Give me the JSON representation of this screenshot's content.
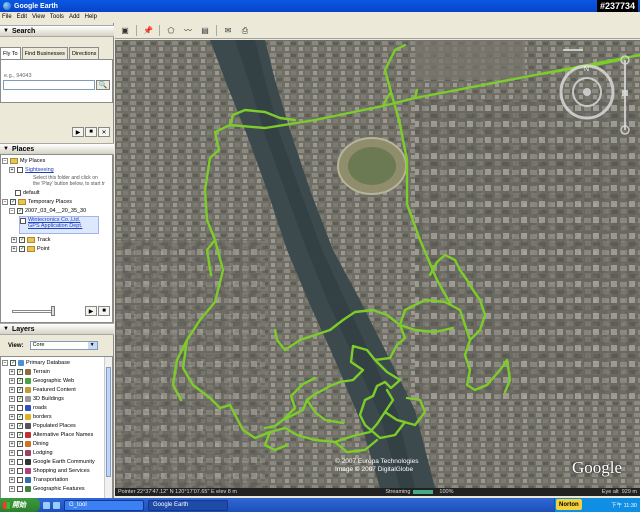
{
  "window": {
    "title": "Google Earth",
    "watermark": "#237734"
  },
  "menu": [
    "File",
    "Edit",
    "View",
    "Tools",
    "Add",
    "Help"
  ],
  "search": {
    "header": "Search",
    "tabs": [
      "Fly To",
      "Find Businesses",
      "Directions"
    ],
    "hint": "e.g., 94043",
    "value": ""
  },
  "places": {
    "header": "Places",
    "my_places": "My Places",
    "sightseeing": "Sightseeing",
    "desc_line1": "Select this folder and click on",
    "desc_line2": "the 'Play' button below, to start tr",
    "default": "default",
    "temporary": "Temporary Places",
    "file": "2007_03_04__20_35_30",
    "company": "Wintecronics Co.,Ltd.",
    "dept": "GPS Application Dept.",
    "track": "Track",
    "point": "Point"
  },
  "layers": {
    "header": "Layers",
    "view_label": "View:",
    "view_value": "Core",
    "items": [
      {
        "label": "Primary Database",
        "color": "#4a8fd8"
      },
      {
        "label": "Terrain",
        "color": "#8c6d3f"
      },
      {
        "label": "Geographic Web",
        "color": "#4aa34a"
      },
      {
        "label": "Featured Content",
        "color": "#c0a030"
      },
      {
        "label": "3D Buildings",
        "color": "#9a9a9a"
      },
      {
        "label": "roads",
        "color": "#3050c0"
      },
      {
        "label": "borders",
        "color": "#e0b020"
      },
      {
        "label": "Populated Places",
        "color": "#555555"
      },
      {
        "label": "Alternative Place Names",
        "color": "#c03030"
      },
      {
        "label": "Dining",
        "color": "#d07020"
      },
      {
        "label": "Lodging",
        "color": "#a04060"
      },
      {
        "label": "Google Earth Community",
        "color": "#333333"
      },
      {
        "label": "Shopping and Services",
        "color": "#b04080"
      },
      {
        "label": "Transportation",
        "color": "#3070b0"
      },
      {
        "label": "Geographic Features",
        "color": "#408040"
      }
    ]
  },
  "map": {
    "credit_line1": "© 2007 Europa Technologies",
    "credit_line2": "Image © 2007 DigitalGlobe",
    "logo": "Google",
    "track_color": "#7ccc2a"
  },
  "status": {
    "pointer": "Pointer  22°37'47.12\" N  120°17'07.65\" E   elev  8 m",
    "streaming": "Streaming",
    "stream_pct": "100%",
    "eye_alt": "Eye alt",
    "eye_alt_val": "929 m"
  },
  "taskbar": {
    "start": "開始",
    "tasks": [
      "G_tool",
      "Google Earth"
    ],
    "norton": "Norton",
    "clock": "下午 11:30"
  }
}
